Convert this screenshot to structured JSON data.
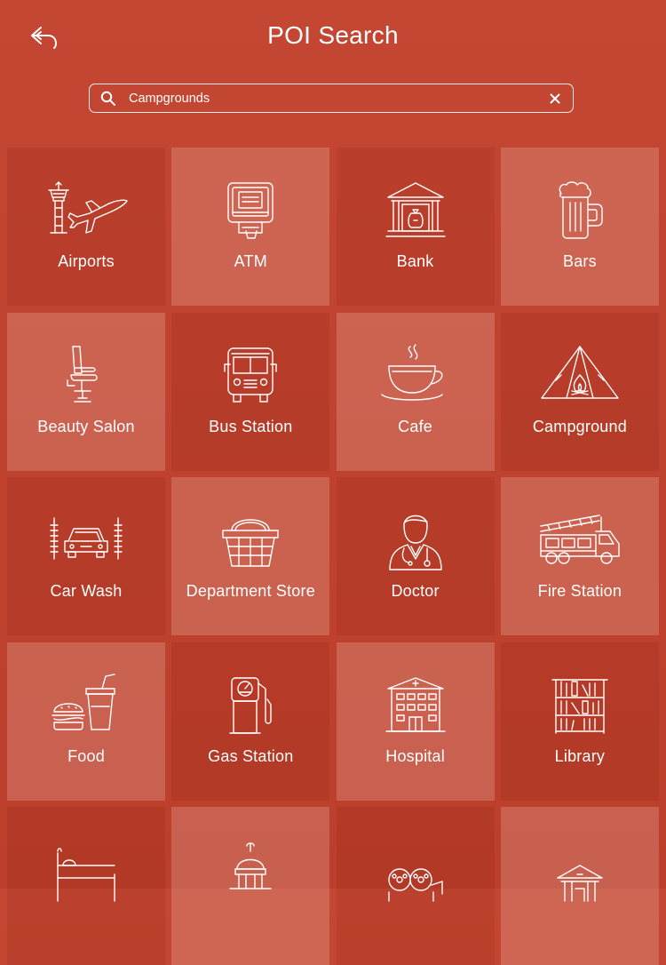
{
  "header": {
    "title": "POI Search"
  },
  "search": {
    "value": "Campgrounds"
  },
  "categories": [
    {
      "label": "Airports",
      "icon": "airport-icon"
    },
    {
      "label": "ATM",
      "icon": "atm-icon"
    },
    {
      "label": "Bank",
      "icon": "bank-icon"
    },
    {
      "label": "Bars",
      "icon": "beer-mug-icon"
    },
    {
      "label": "Beauty Salon",
      "icon": "salon-chair-icon"
    },
    {
      "label": "Bus Station",
      "icon": "bus-icon"
    },
    {
      "label": "Cafe",
      "icon": "coffee-cup-icon"
    },
    {
      "label": "Campground",
      "icon": "tent-icon"
    },
    {
      "label": "Car Wash",
      "icon": "car-wash-icon"
    },
    {
      "label": "Department Store",
      "icon": "shopping-basket-icon"
    },
    {
      "label": "Doctor",
      "icon": "doctor-icon"
    },
    {
      "label": "Fire Station",
      "icon": "fire-truck-icon"
    },
    {
      "label": "Food",
      "icon": "burger-drink-icon"
    },
    {
      "label": "Gas Station",
      "icon": "gas-pump-icon"
    },
    {
      "label": "Hospital",
      "icon": "hospital-icon"
    },
    {
      "label": "Library",
      "icon": "bookshelf-icon"
    },
    {
      "label": "",
      "icon": "bed-icon"
    },
    {
      "label": "",
      "icon": "dome-building-icon"
    },
    {
      "label": "",
      "icon": "film-camera-icon"
    },
    {
      "label": "",
      "icon": "museum-icon"
    }
  ]
}
